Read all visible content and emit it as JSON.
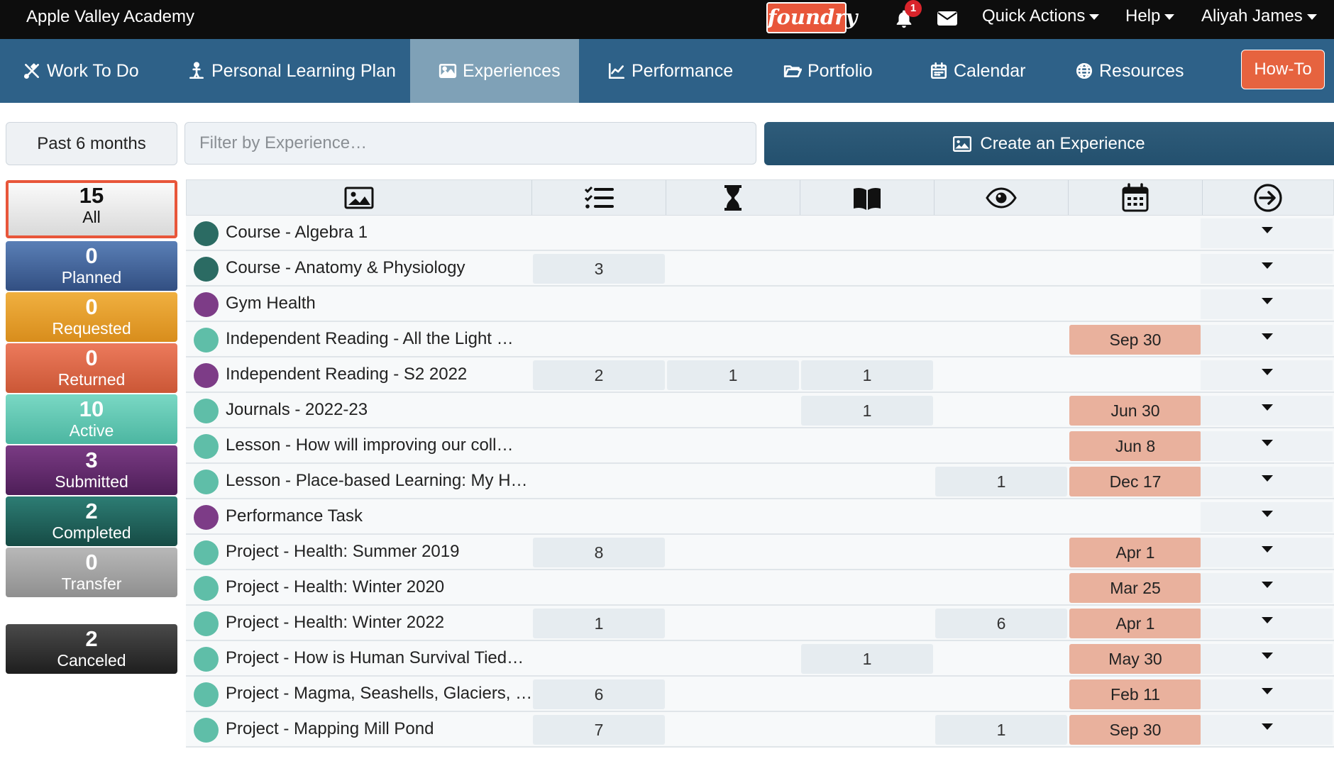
{
  "topbar": {
    "school": "Apple Valley Academy",
    "logo_text": "foundry",
    "notifications_count": "1",
    "quick_actions": "Quick Actions",
    "help": "Help",
    "user": "Aliyah James"
  },
  "nav": {
    "items": [
      {
        "label": "Work To Do",
        "icon": "tools-icon"
      },
      {
        "label": "Personal Learning Plan",
        "icon": "person-icon"
      },
      {
        "label": "Experiences",
        "icon": "image-icon",
        "active": true
      },
      {
        "label": "Performance",
        "icon": "chart-line-icon"
      },
      {
        "label": "Portfolio",
        "icon": "folder-open-icon"
      },
      {
        "label": "Calendar",
        "icon": "calendar-icon"
      },
      {
        "label": "Resources",
        "icon": "globe-icon"
      }
    ],
    "howto": "How-To"
  },
  "controls": {
    "period": "Past 6 months",
    "filter_placeholder": "Filter by Experience…",
    "create_label": "Create an Experience"
  },
  "statuses": [
    {
      "count": "15",
      "label": "All",
      "selected": true
    },
    {
      "count": "0",
      "label": "Planned"
    },
    {
      "count": "0",
      "label": "Requested"
    },
    {
      "count": "0",
      "label": "Returned"
    },
    {
      "count": "10",
      "label": "Active"
    },
    {
      "count": "3",
      "label": "Submitted"
    },
    {
      "count": "2",
      "label": "Completed"
    },
    {
      "count": "0",
      "label": "Transfer"
    },
    {
      "count": "2",
      "label": "Canceled"
    }
  ],
  "table": {
    "columns": [
      "image-icon",
      "checklist-icon",
      "hourglass-icon",
      "book-icon",
      "eye-icon",
      "calendar-icon",
      "arrow-circle-right-icon"
    ],
    "status_colors": {
      "completed": "#2b6b63",
      "submitted": "#7d3c87",
      "active": "#5fbea8"
    },
    "rows": [
      {
        "title": "Course - Algebra 1",
        "status": "completed",
        "tasks": "",
        "pending": "",
        "reading": "",
        "review": "",
        "due": ""
      },
      {
        "title": "Course - Anatomy & Physiology",
        "status": "completed",
        "tasks": "3",
        "pending": "",
        "reading": "",
        "review": "",
        "due": ""
      },
      {
        "title": "Gym Health",
        "status": "submitted",
        "tasks": "",
        "pending": "",
        "reading": "",
        "review": "",
        "due": ""
      },
      {
        "title": "Independent Reading - All the Light …",
        "status": "active",
        "tasks": "",
        "pending": "",
        "reading": "",
        "review": "",
        "due": "Sep 30"
      },
      {
        "title": "Independent Reading - S2 2022",
        "status": "submitted",
        "tasks": "2",
        "pending": "1",
        "reading": "1",
        "review": "",
        "due": ""
      },
      {
        "title": "Journals - 2022-23",
        "status": "active",
        "tasks": "",
        "pending": "",
        "reading": "1",
        "review": "",
        "due": "Jun 30"
      },
      {
        "title": "Lesson - How will improving our coll…",
        "status": "active",
        "tasks": "",
        "pending": "",
        "reading": "",
        "review": "",
        "due": "Jun 8"
      },
      {
        "title": "Lesson - Place-based Learning: My H…",
        "status": "active",
        "tasks": "",
        "pending": "",
        "reading": "",
        "review": "1",
        "due": "Dec 17"
      },
      {
        "title": "Performance Task",
        "status": "submitted",
        "tasks": "",
        "pending": "",
        "reading": "",
        "review": "",
        "due": ""
      },
      {
        "title": "Project - Health: Summer 2019",
        "status": "active",
        "tasks": "8",
        "pending": "",
        "reading": "",
        "review": "",
        "due": "Apr 1"
      },
      {
        "title": "Project - Health: Winter 2020",
        "status": "active",
        "tasks": "",
        "pending": "",
        "reading": "",
        "review": "",
        "due": "Mar 25"
      },
      {
        "title": "Project - Health: Winter 2022",
        "status": "active",
        "tasks": "1",
        "pending": "",
        "reading": "",
        "review": "6",
        "due": "Apr 1"
      },
      {
        "title": "Project - How is Human Survival Tied…",
        "status": "active",
        "tasks": "",
        "pending": "",
        "reading": "1",
        "review": "",
        "due": "May 30"
      },
      {
        "title": "Project - Magma, Seashells, Glaciers, …",
        "status": "active",
        "tasks": "6",
        "pending": "",
        "reading": "",
        "review": "",
        "due": "Feb 11"
      },
      {
        "title": "Project - Mapping Mill Pond",
        "status": "active",
        "tasks": "7",
        "pending": "",
        "reading": "",
        "review": "1",
        "due": "Sep 30"
      }
    ]
  }
}
